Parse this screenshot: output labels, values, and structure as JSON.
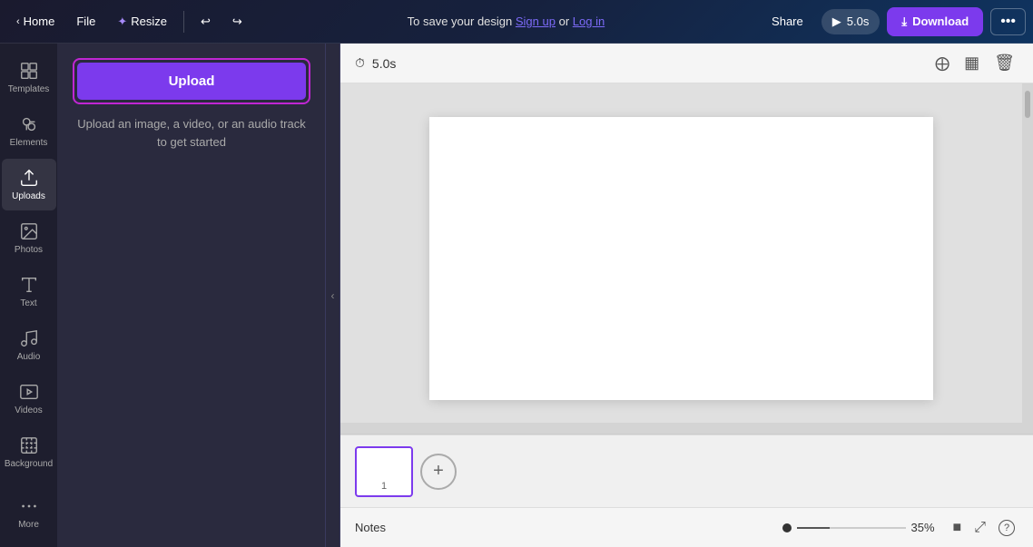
{
  "navbar": {
    "home_label": "Home",
    "file_label": "File",
    "resize_label": "Resize",
    "save_prompt": "To save your design ",
    "signup_label": "Sign up",
    "or_label": " or ",
    "login_label": "Log in",
    "share_label": "Share",
    "play_time": "5.0s",
    "download_label": "Download",
    "more_icon": "•••"
  },
  "sidebar": {
    "items": [
      {
        "label": "Templates",
        "icon": "templates"
      },
      {
        "label": "Elements",
        "icon": "elements"
      },
      {
        "label": "Uploads",
        "icon": "uploads"
      },
      {
        "label": "Photos",
        "icon": "photos"
      },
      {
        "label": "Text",
        "icon": "text"
      },
      {
        "label": "Audio",
        "icon": "audio"
      },
      {
        "label": "Videos",
        "icon": "videos"
      },
      {
        "label": "Background",
        "icon": "background"
      },
      {
        "label": "More",
        "icon": "more"
      }
    ]
  },
  "uploads_panel": {
    "upload_btn_label": "Upload",
    "hint_text": "Upload an image, a video, or an\naudio track to get started"
  },
  "canvas": {
    "duration": "5.0s",
    "page_number": "1",
    "zoom_percent": "35%"
  },
  "bottom_bar": {
    "notes_label": "Notes"
  }
}
